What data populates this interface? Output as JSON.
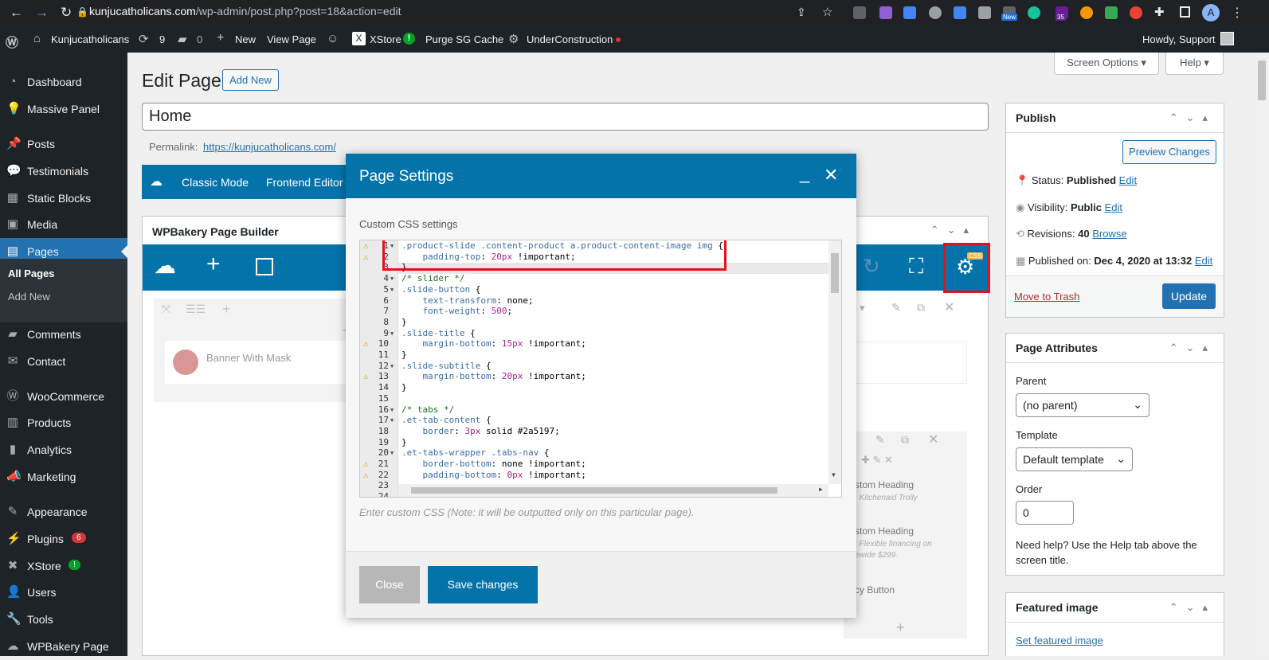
{
  "browser": {
    "url_domain": "kunjucatholicans.com",
    "url_path": "/wp-admin/post.php?post=18&action=edit",
    "new_badge": "New",
    "badge_35": "35",
    "avatar_letter": "A"
  },
  "adminbar": {
    "site_name": "Kunjucatholicans",
    "updates": "9",
    "comments": "0",
    "new": "New",
    "view_page": "View Page",
    "xstore": "XStore",
    "purge": "Purge SG Cache",
    "under_construction": "UnderConstruction",
    "howdy": "Howdy, Support"
  },
  "sidebar": {
    "items": [
      {
        "label": "Dashboard",
        "icon": "dashboard-icon"
      },
      {
        "label": "Massive Panel",
        "icon": "lightbulb-icon"
      },
      {
        "label": "Posts",
        "icon": "pin-icon"
      },
      {
        "label": "Testimonials",
        "icon": "speech-bubble-icon"
      },
      {
        "label": "Static Blocks",
        "icon": "grid-icon"
      },
      {
        "label": "Media",
        "icon": "media-icon"
      },
      {
        "label": "Pages",
        "icon": "pages-icon"
      },
      {
        "label": "Comments",
        "icon": "comment-icon"
      },
      {
        "label": "Contact",
        "icon": "mail-icon"
      },
      {
        "label": "WooCommerce",
        "icon": "woo-icon"
      },
      {
        "label": "Products",
        "icon": "box-icon"
      },
      {
        "label": "Analytics",
        "icon": "bar-chart-icon"
      },
      {
        "label": "Marketing",
        "icon": "megaphone-icon"
      },
      {
        "label": "Appearance",
        "icon": "brush-icon"
      },
      {
        "label": "Plugins",
        "icon": "plug-icon"
      },
      {
        "label": "XStore",
        "icon": "xstore-icon"
      },
      {
        "label": "Users",
        "icon": "user-icon"
      },
      {
        "label": "Tools",
        "icon": "wrench-icon"
      },
      {
        "label": "WPBakery Page",
        "icon": "wpbakery-icon"
      }
    ],
    "sub_all_pages": "All Pages",
    "sub_add_new": "Add New",
    "plugins_badge": "6",
    "xstore_badge": "!"
  },
  "main": {
    "heading": "Edit Page",
    "add_new": "Add New",
    "title_value": "Home",
    "permalink_label": "Permalink:",
    "permalink_url": "https://kunjucatholicans.com/",
    "screen_options": "Screen Options ▾",
    "help": "Help ▾",
    "classic_mode": "Classic Mode",
    "frontend_editor": "Frontend Editor",
    "builder_title": "WPBakery Page Builder",
    "banner_label": "Banner With Mask",
    "custom_heading_1": "stom Heading",
    "custom_heading_1_sub": ": Kitchenaid Trolly",
    "custom_heading_2": "stom Heading",
    "custom_heading_2_sub": ": Flexible financing on",
    "custom_heading_2_sub2": "ewide $299.",
    "fancy_button": "cy Button",
    "css_badge": "CSS"
  },
  "publish": {
    "title": "Publish",
    "preview": "Preview Changes",
    "status_label": "Status:",
    "status_value": "Published",
    "visibility_label": "Visibility:",
    "visibility_value": "Public",
    "revisions_label": "Revisions:",
    "revisions_value": "40",
    "browse": "Browse",
    "published_on_label": "Published on:",
    "published_on_value": "Dec 4, 2020 at 13:32",
    "edit": "Edit",
    "trash": "Move to Trash",
    "update": "Update"
  },
  "attributes": {
    "title": "Page Attributes",
    "parent_label": "Parent",
    "parent_value": "(no parent)",
    "template_label": "Template",
    "template_value": "Default template",
    "order_label": "Order",
    "order_value": "0",
    "help_text_1": "Need help? Use the Help tab above the",
    "help_text_2": "screen title."
  },
  "featured": {
    "title": "Featured image",
    "set_link": "Set featured image"
  },
  "modal": {
    "title": "Page Settings",
    "section_label": "Custom CSS settings",
    "hint": "Enter custom CSS (Note: it will be outputted only on this particular page).",
    "close": "Close",
    "save": "Save changes",
    "code_lines": [
      {
        "n": "1",
        "text": ".product-slide .content-product a.product-content-image img {",
        "warn": true,
        "fold": true
      },
      {
        "n": "2",
        "text": "    padding-top: 20px !important;",
        "warn": true,
        "fold": false
      },
      {
        "n": "3",
        "text": "}",
        "warn": false,
        "fold": false
      },
      {
        "n": "4",
        "text": "/* slider */",
        "warn": false,
        "fold": true
      },
      {
        "n": "5",
        "text": ".slide-button {",
        "warn": false,
        "fold": true
      },
      {
        "n": "6",
        "text": "    text-transform: none;",
        "warn": false,
        "fold": false
      },
      {
        "n": "7",
        "text": "    font-weight: 500;",
        "warn": false,
        "fold": false
      },
      {
        "n": "8",
        "text": "}",
        "warn": false,
        "fold": false
      },
      {
        "n": "9",
        "text": ".slide-title {",
        "warn": false,
        "fold": true
      },
      {
        "n": "10",
        "text": "    margin-bottom: 15px !important;",
        "warn": true,
        "fold": false
      },
      {
        "n": "11",
        "text": "}",
        "warn": false,
        "fold": false
      },
      {
        "n": "12",
        "text": ".slide-subtitle {",
        "warn": false,
        "fold": true
      },
      {
        "n": "13",
        "text": "    margin-bottom: 20px !important;",
        "warn": true,
        "fold": false
      },
      {
        "n": "14",
        "text": "}",
        "warn": false,
        "fold": false
      },
      {
        "n": "15",
        "text": "",
        "warn": false,
        "fold": false
      },
      {
        "n": "16",
        "text": "/* tabs */",
        "warn": false,
        "fold": true
      },
      {
        "n": "17",
        "text": ".et-tab-content {",
        "warn": false,
        "fold": true
      },
      {
        "n": "18",
        "text": "    border: 3px solid #2a5197;",
        "warn": false,
        "fold": false
      },
      {
        "n": "19",
        "text": "}",
        "warn": false,
        "fold": false
      },
      {
        "n": "20",
        "text": ".et-tabs-wrapper .tabs-nav {",
        "warn": false,
        "fold": true
      },
      {
        "n": "21",
        "text": "    border-bottom: none !important;",
        "warn": true,
        "fold": false
      },
      {
        "n": "22",
        "text": "    padding-bottom: 0px !important;",
        "warn": true,
        "fold": false
      },
      {
        "n": "23",
        "text": "",
        "warn": false,
        "fold": false
      },
      {
        "n": "24",
        "text": "",
        "warn": false,
        "fold": false
      }
    ]
  },
  "colors": {
    "wp_blue": "#2271b1",
    "wpb_blue": "#0473aa",
    "highlight_red": "#e3111b"
  }
}
